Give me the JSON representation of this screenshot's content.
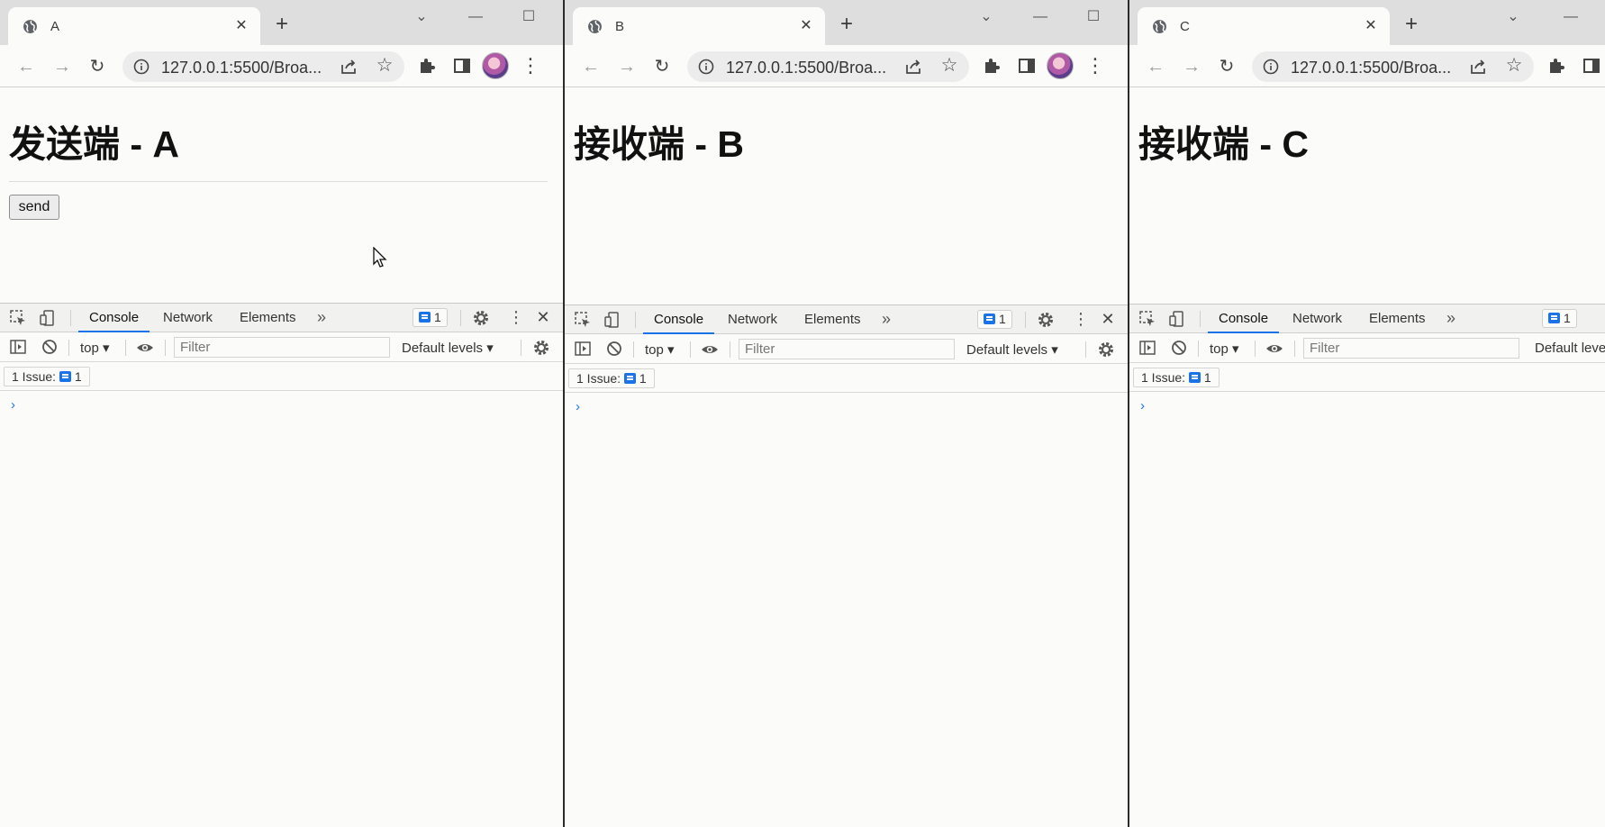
{
  "common": {
    "url": "127.0.0.1:5500/Broa...",
    "devtools": {
      "tabs": [
        "Console",
        "Network",
        "Elements"
      ],
      "issue_count": "1",
      "context": "top",
      "filter_placeholder": "Filter",
      "levels": "Default levels",
      "issues_label": "1 Issue:",
      "prompt": "›"
    }
  },
  "windows": [
    {
      "tab_title": "A",
      "heading": "发送端 - A",
      "send_label": "send"
    },
    {
      "tab_title": "B",
      "heading": "接收端 - B"
    },
    {
      "tab_title": "C",
      "heading": "接收端 - C"
    }
  ],
  "colors": {
    "accent": "#1a73e8",
    "chrome_frame": "#dedede",
    "page_bg": "#fbfbf9"
  }
}
